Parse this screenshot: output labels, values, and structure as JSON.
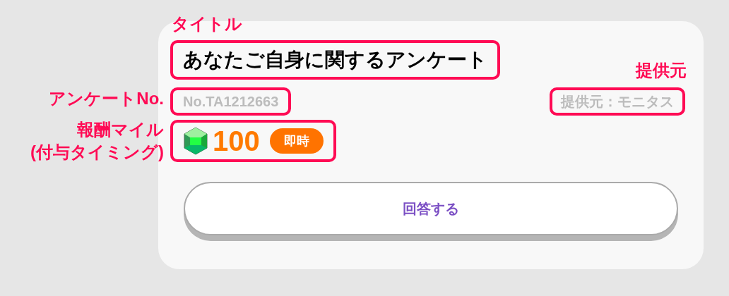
{
  "card": {
    "title": "あなたご自身に関するアンケート",
    "survey_no": "No.TA1212663",
    "provider": "提供元：モニタス",
    "reward": {
      "amount": "100",
      "timing": "即時"
    },
    "button": "回答する"
  },
  "annotations": [
    {
      "lines": [
        "タイトル"
      ]
    },
    {
      "lines": [
        "アンケートNo."
      ]
    },
    {
      "lines": [
        "報酬マイル",
        "(付与タイミング)"
      ]
    },
    {
      "lines": [
        "提供元"
      ]
    }
  ]
}
